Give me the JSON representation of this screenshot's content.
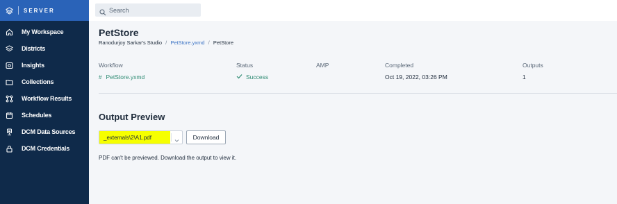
{
  "brand": {
    "text": "SERVER",
    "color": "#2a63b8"
  },
  "sidebar": {
    "background": "#0f2a4a",
    "items": [
      {
        "label": "My Workspace",
        "icon": "home-icon"
      },
      {
        "label": "Districts",
        "icon": "layers-icon"
      },
      {
        "label": "Insights",
        "icon": "insights-icon"
      },
      {
        "label": "Collections",
        "icon": "folder-icon"
      },
      {
        "label": "Workflow Results",
        "icon": "workflow-icon"
      },
      {
        "label": "Schedules",
        "icon": "calendar-icon"
      },
      {
        "label": "DCM Data Sources",
        "icon": "data-source-icon"
      },
      {
        "label": "DCM Credentials",
        "icon": "lock-icon"
      }
    ]
  },
  "search": {
    "placeholder": "Search",
    "icon": "search-icon"
  },
  "page": {
    "title": "PetStore",
    "breadcrumb": {
      "studio": "Ranodurjoy Sarkar's Studio",
      "separator": "/",
      "workflow_link": "PetStore.yxmd",
      "current": "PetStore"
    }
  },
  "details": {
    "headers": {
      "workflow": "Workflow",
      "status": "Status",
      "amp": "AMP",
      "completed": "Completed",
      "outputs": "Outputs"
    },
    "values": {
      "workflow": "PetStore.yxmd",
      "status": "Success",
      "amp": "",
      "completed": "Oct 19, 2022, 03:26 PM",
      "outputs": "1"
    },
    "status_color": "#2d8a72"
  },
  "output_preview": {
    "title": "Output Preview",
    "selected_file": "_externals\\2\\A1.pdf",
    "download_label": "Download",
    "message": "PDF can't be previewed. Download the output to view it.",
    "highlight_color": "#f6ff00"
  }
}
